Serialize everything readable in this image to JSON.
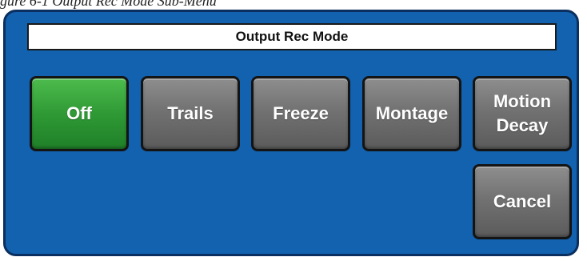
{
  "caption": "gure 6-1 Output Rec Mode Sub-Menu",
  "menu": {
    "title": "Output Rec Mode",
    "buttons": {
      "off": "Off",
      "trails": "Trails",
      "freeze": "Freeze",
      "montage": "Montage",
      "motion_decay_line1": "Motion",
      "motion_decay_line2": "Decay",
      "cancel": "Cancel"
    },
    "selected": "Off"
  },
  "colors": {
    "panel_background": "#1262b0",
    "selected_button": "#2f9a35",
    "button": "#727272"
  }
}
